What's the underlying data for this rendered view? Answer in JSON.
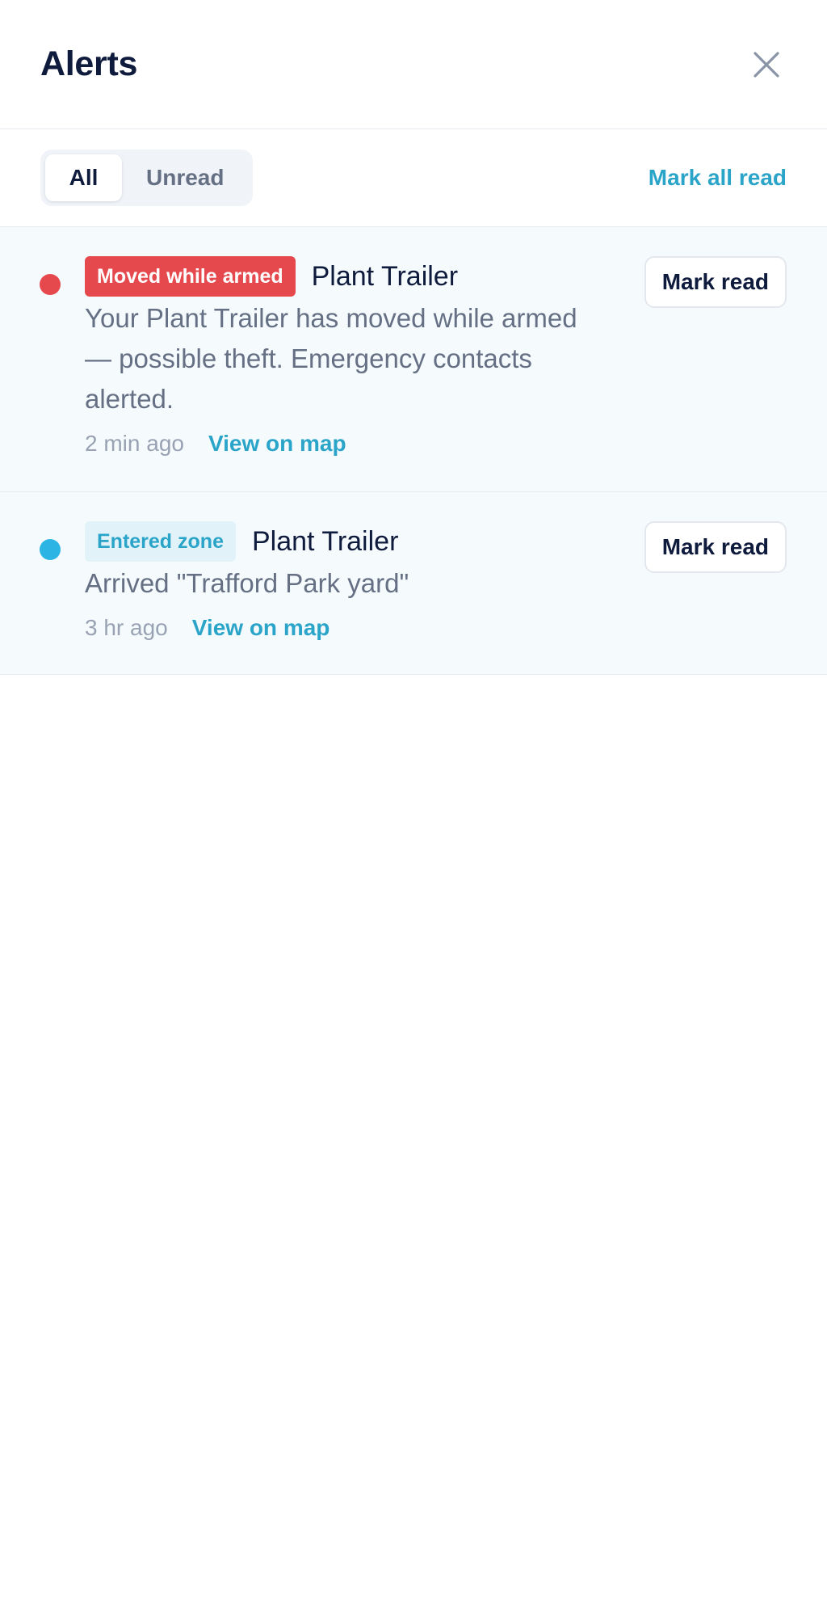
{
  "header": {
    "title": "Alerts",
    "close_icon": "close-icon"
  },
  "filters": {
    "tabs": [
      {
        "label": "All",
        "active": true
      },
      {
        "label": "Unread",
        "active": false
      }
    ],
    "mark_all_label": "Mark all read"
  },
  "alerts": [
    {
      "badge": "Moved while armed",
      "badge_color": "#e5484d",
      "dot_color": "#e5484d",
      "device": "Plant Trailer",
      "message": "Your Plant Trailer has moved while armed — possible theft. Emergency contacts alerted.",
      "time": "2 min ago",
      "link": "View on map",
      "action": "Mark read"
    },
    {
      "badge": "Entered zone",
      "badge_color": "#2aa4c8",
      "dot_color": "#2cb5e4",
      "device": "Plant Trailer",
      "message": "Arrived \"Trafford Park yard\"",
      "time": "3 hr ago",
      "link": "View on map",
      "action": "Mark read"
    }
  ]
}
